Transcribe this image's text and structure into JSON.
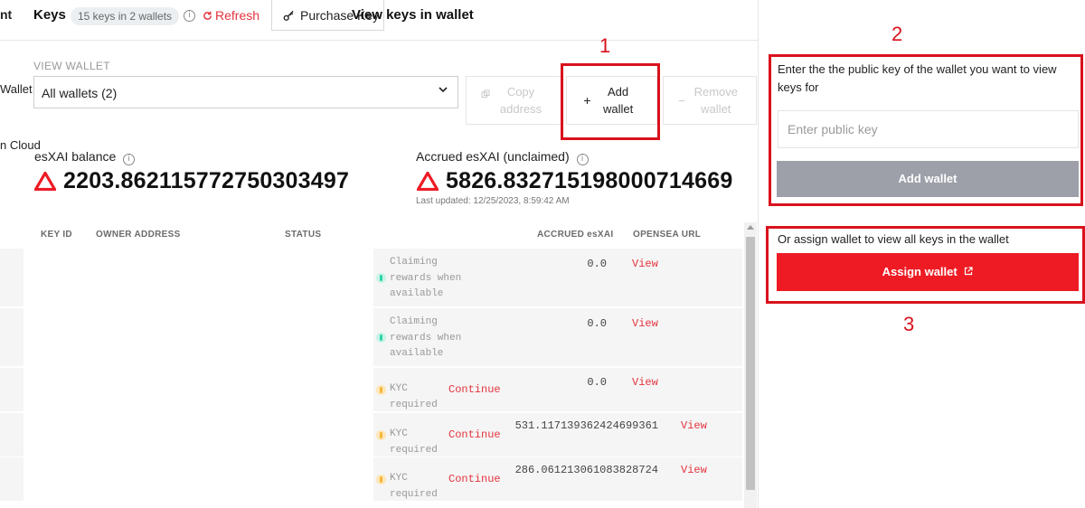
{
  "sidebar": {
    "text_top": "nt",
    "text_wallet": "Wallet",
    "text_cloud": "n Cloud"
  },
  "header": {
    "title": "Keys",
    "keys_badge": "15 keys in 2 wallets",
    "info_glyph": "i",
    "refresh_label": "Refresh",
    "purchase_label": "Purchase Key",
    "modal_title": "View keys in wallet"
  },
  "view_wallet": {
    "label": "VIEW WALLET",
    "selected": "All wallets (2)",
    "copy_label": "Copy address",
    "add_label": "Add wallet",
    "add_prefix": "+",
    "remove_label": "Remove wallet",
    "remove_prefix": "−"
  },
  "balances": {
    "esxai_label": "esXAI balance",
    "esxai_value": "2203.862115772750303497",
    "accrued_label": "Accrued esXAI (unclaimed)",
    "accrued_value": "5826.832715198000714669",
    "last_updated": "Last updated: 12/25/2023, 8:59:42 AM"
  },
  "table": {
    "headers": {
      "key_id": "KEY ID",
      "owner": "OWNER ADDRESS",
      "status": "STATUS",
      "accrued": "ACCRUED esXAI",
      "opensea": "OPENSEA URL"
    },
    "rows": [
      {
        "status_lines": [
          "Claiming",
          "rewards when",
          "available"
        ],
        "continue": "",
        "accrued": "0.0",
        "link": "View"
      },
      {
        "status_lines": [
          "Claiming",
          "rewards when",
          "available"
        ],
        "continue": "",
        "accrued": "0.0",
        "link": "View"
      },
      {
        "status_lines": [
          "KYC",
          "required"
        ],
        "continue": "Continue",
        "accrued": "0.0",
        "link": "View"
      },
      {
        "status_lines": [
          "KYC",
          "required"
        ],
        "continue": "Continue",
        "accrued": "531.117139362424699361",
        "link": "View"
      },
      {
        "status_lines": [
          "KYC",
          "required"
        ],
        "continue": "Continue",
        "accrued": "286.061213061083828724",
        "link": "View"
      }
    ]
  },
  "panel": {
    "description": "Enter the the public key of the wallet you want to view keys for",
    "input_placeholder": "Enter public key",
    "add_wallet_label": "Add wallet",
    "or_assign_text": "Or assign wallet to view all keys in the wallet",
    "assign_label": "Assign wallet"
  },
  "annotations": {
    "one": "1",
    "two": "2",
    "three": "3"
  },
  "colors": {
    "accent_red": "#ee1b24",
    "link_red": "#e5343e",
    "annotation_red": "#d9121d",
    "status_green": "#2ed3a6",
    "status_yellow": "#f5b73b",
    "disabled_button": "#9da0a8"
  }
}
